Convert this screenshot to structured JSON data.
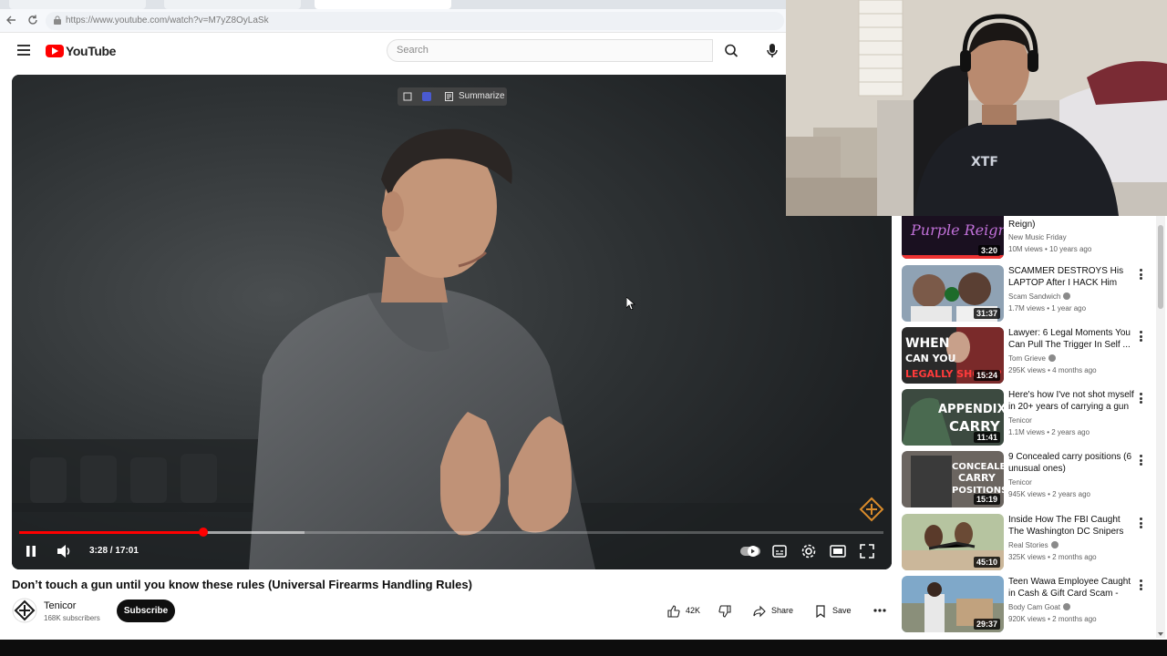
{
  "browser": {
    "url": "https://www.youtube.com/watch?v=M7yZ8OyLaSk"
  },
  "header": {
    "logo_text": "YouTube",
    "search_placeholder": "Search"
  },
  "player": {
    "summarize_label": "Summarize",
    "time": "3:28 / 17:01",
    "progress_played": 0.213,
    "progress_loaded": 0.33
  },
  "video": {
    "title": "Don’t touch a gun until you know these rules (Universal Firearms Handling Rules)",
    "channel_name": "Tenicor",
    "channel_subs": "168K subscribers",
    "subscribe_label": "Subscribe",
    "likes": "42K",
    "share_label": "Share",
    "save_label": "Save"
  },
  "sidebar": {
    "items": [
      {
        "title": "Reign)",
        "channel": "New Music Friday",
        "verified": false,
        "meta": "10M views • 10 years ago",
        "duration": "3:20",
        "thumb_text": "Purple Reign",
        "kebab": false
      },
      {
        "title": "SCAMMER DESTROYS His LAPTOP After I HACK Him",
        "channel": "Scam Sandwich",
        "verified": true,
        "meta": "1.7M views • 1 year ago",
        "duration": "31:37",
        "thumb_text": "",
        "kebab": true
      },
      {
        "title": "Lawyer: 6 Legal Moments You Can Pull The Trigger In Self ...",
        "channel": "Tom Grieve",
        "verified": true,
        "meta": "295K views • 4 months ago",
        "duration": "15:24",
        "thumb_text": "WHEN CAN YOU LEGALLY SHOOT?",
        "kebab": true
      },
      {
        "title": "Here's how I've not shot myself in 20+ years of carrying a gun",
        "channel": "Tenicor",
        "verified": false,
        "meta": "1.1M views • 2 years ago",
        "duration": "11:41",
        "thumb_text": "APPENDIX CARRY",
        "kebab": true
      },
      {
        "title": "9 Concealed carry positions (6 unusual ones)",
        "channel": "Tenicor",
        "verified": false,
        "meta": "945K views • 2 years ago",
        "duration": "15:19",
        "thumb_text": "CONCEALED CARRY POSITIONS",
        "kebab": true
      },
      {
        "title": "Inside How The FBI Caught The Washington DC Snipers",
        "channel": "Real Stories",
        "verified": true,
        "meta": "325K views • 2 months ago",
        "duration": "45:10",
        "thumb_text": "",
        "kebab": true
      },
      {
        "title": "Teen Wawa Employee Caught in Cash & Gift Card Scam - Dad's ...",
        "channel": "Body Cam Goat",
        "verified": true,
        "meta": "920K views • 2 months ago",
        "duration": "29:37",
        "thumb_text": "",
        "kebab": true
      }
    ]
  }
}
